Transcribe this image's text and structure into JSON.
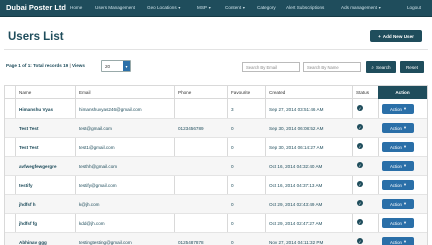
{
  "nav": {
    "brand": "Dubai Poster Ltd",
    "items": [
      {
        "label": "Home"
      },
      {
        "label": "Users Management"
      },
      {
        "label": "Geo Locations",
        "dropdown": true
      },
      {
        "label": "MSP",
        "dropdown": true
      },
      {
        "label": "Content",
        "dropdown": true
      },
      {
        "label": "Category"
      },
      {
        "label": "Alert Subscriptions"
      },
      {
        "label": "Ads management",
        "dropdown": true
      },
      {
        "label": "Logout"
      }
    ]
  },
  "page": {
    "title": "Users List",
    "add_button": "Add New User"
  },
  "controls": {
    "page_label": "Page 1 of 1:",
    "total_records": "Total records 19",
    "views_label": "Views",
    "per_page": "20",
    "search_email_placeholder": "Search By Email",
    "search_name_placeholder": "Search By Name",
    "search_button": "Search",
    "reset_button": "Reset"
  },
  "table": {
    "columns": [
      "Name",
      "Email",
      "Phone",
      "Favourite",
      "Created",
      "Status",
      "Action"
    ],
    "action_label": "Action",
    "rows": [
      {
        "name": "Himanshu Vyas",
        "email": "himanshuvyas246@gmail.com",
        "phone": "",
        "favourite": "3",
        "created": "Sep 27, 2014 03:51:46 AM",
        "status": "active"
      },
      {
        "name": "Test Test",
        "email": "test@gmail.com",
        "phone": "0123456789",
        "favourite": "0",
        "created": "Sep 30, 2014 06:08:52 AM",
        "status": "active"
      },
      {
        "name": "Test Test",
        "email": "test1@gmail.com",
        "phone": "",
        "favourite": "0",
        "created": "Sep 30, 2014 06:14:27 AM",
        "status": "active"
      },
      {
        "name": "avfwegfewgergre",
        "email": "testhh@gmail.com",
        "phone": "",
        "favourite": "0",
        "created": "Oct 16, 2014 04:32:40 AM",
        "status": "active"
      },
      {
        "name": "testify",
        "email": "testify@gmail.com",
        "phone": "",
        "favourite": "0",
        "created": "Oct 16, 2014 04:37:13 AM",
        "status": "active"
      },
      {
        "name": "jhdfsf h",
        "email": "k@jh.com",
        "phone": "",
        "favourite": "0",
        "created": "Oct 29, 2014 02:43:49 AM",
        "status": "active"
      },
      {
        "name": "jhdfsf fg",
        "email": "kdd@jh.com",
        "phone": "",
        "favourite": "0",
        "created": "Oct 29, 2014 02:47:27 AM",
        "status": "active"
      },
      {
        "name": "Abhinav ggg",
        "email": "testingtesting@gmail.com",
        "phone": "0125487878",
        "favourite": "0",
        "created": "Nov 27, 2014 04:11:32 PM",
        "status": "active"
      }
    ]
  },
  "colors": {
    "nav_bg": "#1f4d5c",
    "primary": "#1f4d5c",
    "action_button": "#2a6fa8"
  }
}
